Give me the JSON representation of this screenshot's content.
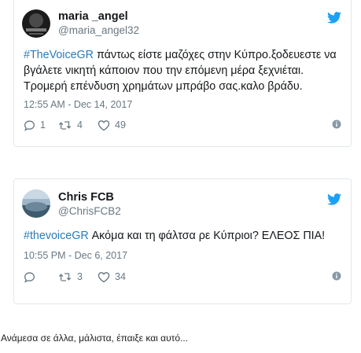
{
  "tweets": [
    {
      "name": "maria _angel",
      "handle": "@maria_angel32",
      "hashtag": "#TheVoiceGR",
      "lines": [
        "πάντως είστε μαζόχες στην Κύπρο.ξοδευεστε να",
        "βγάλετε νικητή κάποιον που την επόμενη μέρα ξεχνιέται.",
        "Τρομερή επένδυση χρημάτων μπράβο σας.καλο βράδυ."
      ],
      "timestamp": "12:55 AM - Dec 14, 2017",
      "replies": "1",
      "retweets": "4",
      "likes": "49"
    },
    {
      "name": "Chris FCB",
      "handle": "@ChrisFCB2",
      "hashtag": "#thevoiceGR",
      "lines": [
        "Ακόμα και τη φάλτσα ρε Κύπριοι? ΕΛΕΟΣ ΠΙΑ!"
      ],
      "timestamp": "10:55 PM - Dec 6, 2017",
      "replies": "",
      "retweets": "3",
      "likes": "34"
    }
  ],
  "caption": "Ανάμεσα σε άλλα, μάλιστα, έπαιξε και αυτό...",
  "colors": {
    "link": "#2b7bb9",
    "twitter_blue": "#1da1f2",
    "muted": "#697882",
    "border": "#e1e8ed"
  },
  "icons": [
    "avatar",
    "twitter-bird-icon",
    "reply-icon",
    "retweet-icon",
    "heart-icon",
    "info-icon"
  ]
}
